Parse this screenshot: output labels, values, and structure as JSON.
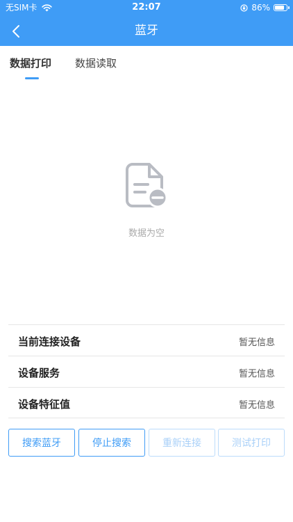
{
  "status_bar": {
    "carrier": "无SIM卡",
    "time": "22:07",
    "battery": "86%",
    "battery_level": 0.86
  },
  "nav": {
    "title": "蓝牙",
    "back_icon": "chevron-left-icon"
  },
  "tabs": [
    {
      "label": "数据打印",
      "active": true
    },
    {
      "label": "数据读取",
      "active": false
    }
  ],
  "empty_state": {
    "icon": "empty-document-icon",
    "text": "数据为空"
  },
  "info": [
    {
      "label": "当前连接设备",
      "value": "暂无信息"
    },
    {
      "label": "设备服务",
      "value": "暂无信息"
    },
    {
      "label": "设备特征值",
      "value": "暂无信息"
    }
  ],
  "buttons": [
    {
      "label": "搜索蓝牙",
      "enabled": true
    },
    {
      "label": "停止搜索",
      "enabled": true
    },
    {
      "label": "重新连接",
      "enabled": false
    },
    {
      "label": "测试打印",
      "enabled": false
    }
  ],
  "colors": {
    "primary": "#3f9cf6",
    "disabled": "#a9d0f8",
    "empty_icon": "#b9bcc3",
    "empty_text": "#aaaaaa"
  }
}
